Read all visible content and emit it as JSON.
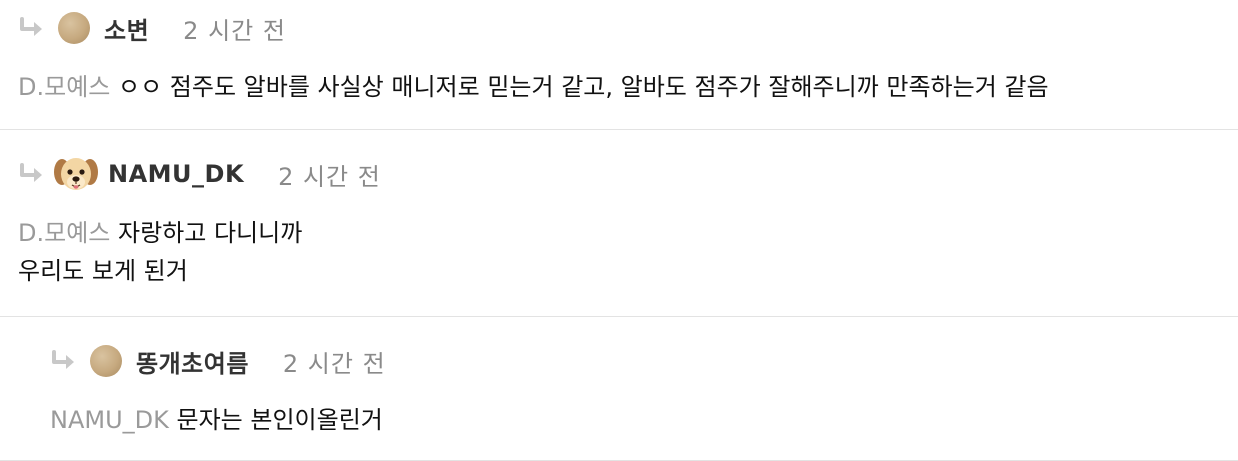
{
  "comments": [
    {
      "author": "소변",
      "time": "2 시간 전",
      "mention": "D.모예스",
      "lines": [
        "ㅇㅇ 점주도 알바를 사실상 매니저로 믿는거 같고, 알바도 점주가 잘해주니까 만족하는거 같음"
      ]
    },
    {
      "author": "NAMU_DK",
      "time": "2 시간 전",
      "mention": "D.모예스",
      "lines": [
        "자랑하고 다니니까",
        "우리도 보게 된거"
      ]
    },
    {
      "author": "똥개초여름",
      "time": "2 시간 전",
      "mention": "NAMU_DK",
      "lines": [
        "문자는 본인이올린거"
      ]
    }
  ],
  "icons": {
    "reply": "reply-arrow-icon",
    "avatar_plain": "avatar-circle",
    "avatar_dog": "puppy-avatar"
  },
  "colors": {
    "mention": "#9a9a9a",
    "time": "#8a8a8a",
    "author": "#333333",
    "divider": "#e3e3e3",
    "avatar": "#c6a97f"
  }
}
